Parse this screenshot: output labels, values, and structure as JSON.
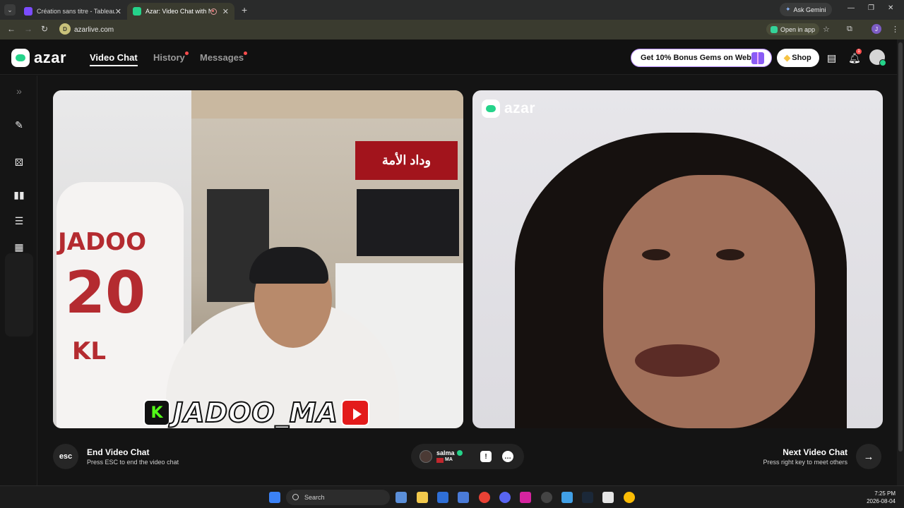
{
  "browser": {
    "tabs": [
      {
        "title": "Création sans titre - Tableau bla",
        "icon_color": "#7b4cff",
        "active": false
      },
      {
        "title": "Azar: Video Chat with New",
        "icon_color": "#25d38a",
        "active": true,
        "recording": true
      }
    ],
    "ask_gemini": "Ask Gemini",
    "url": "azarlive.com",
    "open_in_app": "Open in app",
    "profile_initial": "J"
  },
  "app": {
    "logo": "azar",
    "nav": {
      "video_chat": "Video Chat",
      "history": "History",
      "messages": "Messages"
    },
    "bonus_label": "Get 10% Bonus Gems on Web!",
    "shop_label": "Shop",
    "notification_count": "1",
    "accent": "#25d38a"
  },
  "left_video": {
    "jersey_name": "JADOO",
    "jersey_number": "20",
    "jersey_sub": "KL",
    "scarf_text": "وداد الأمة",
    "banner_kick": "K",
    "banner_name": "JADOO_MA"
  },
  "right_video": {
    "watermark": "azar"
  },
  "controls": {
    "esc_label": "esc",
    "end_title": "End Video Chat",
    "end_subtitle": "Press ESC to end the video chat",
    "peer_name": "salma",
    "peer_country": "MA",
    "next_title": "Next Video Chat",
    "next_subtitle": "Press right key to meet others"
  },
  "taskbar": {
    "search_placeholder": "Search",
    "time": "7:25 PM",
    "date": "2026-08-04"
  }
}
